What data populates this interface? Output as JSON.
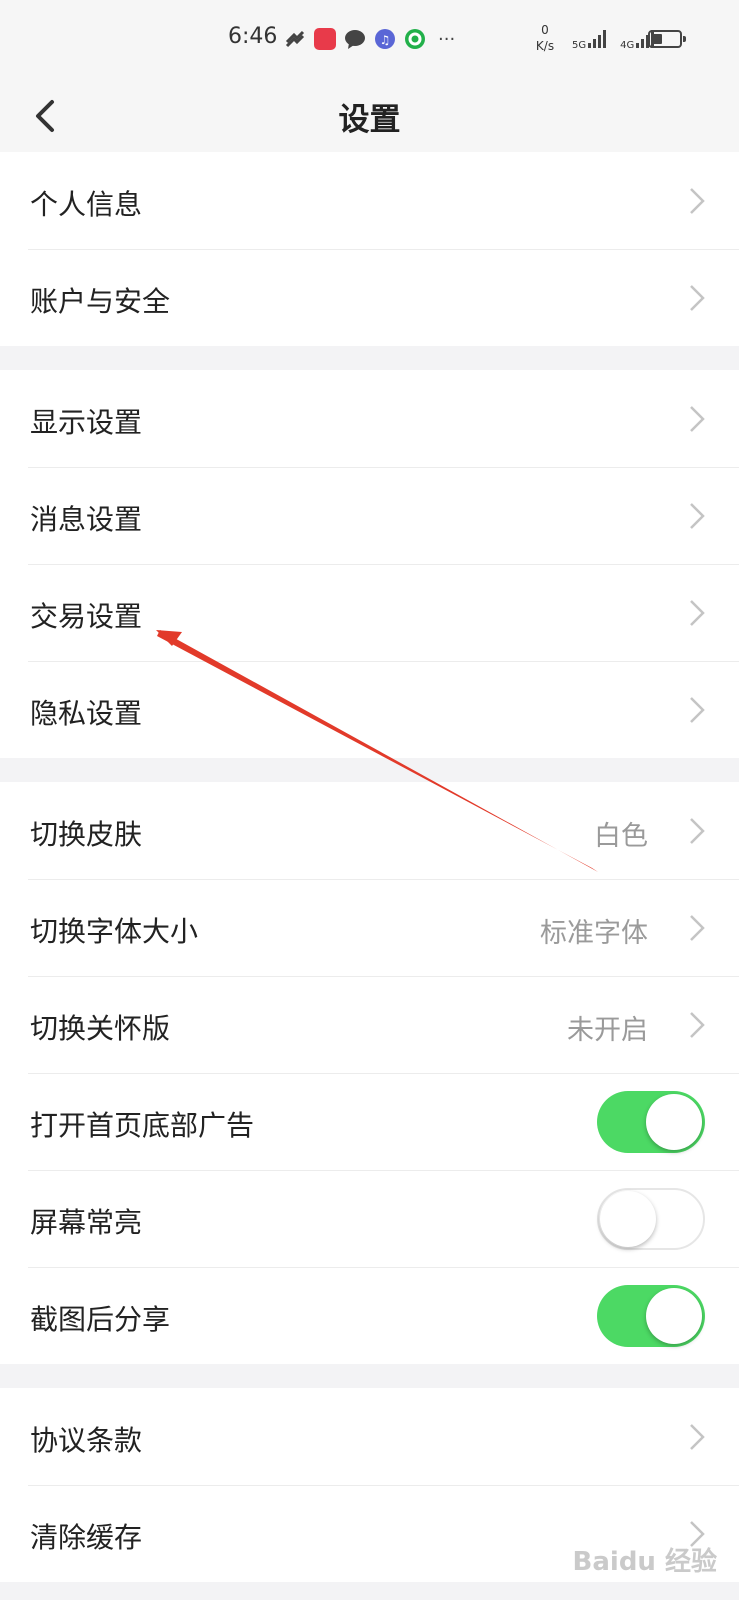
{
  "status_bar": {
    "time": "6:46",
    "net_speed_value": "0",
    "net_speed_unit": "K/s",
    "signal_1": "5G",
    "signal_2": "4G",
    "icons": [
      "heart-link-icon",
      "app-red-icon",
      "chat-bubble-icon",
      "music-icon",
      "green-c-icon",
      "more-dots-icon"
    ]
  },
  "nav": {
    "title": "设置",
    "back_icon": "chevron-left-icon"
  },
  "groups": [
    {
      "items": [
        {
          "label": "个人信息"
        },
        {
          "label": "账户与安全"
        }
      ]
    },
    {
      "items": [
        {
          "label": "显示设置"
        },
        {
          "label": "消息设置"
        },
        {
          "label": "交易设置"
        },
        {
          "label": "隐私设置"
        }
      ]
    },
    {
      "items": [
        {
          "label": "切换皮肤",
          "value": "白色"
        },
        {
          "label": "切换字体大小",
          "value": "标准字体"
        },
        {
          "label": "切换关怀版",
          "value": "未开启"
        },
        {
          "label": "打开首页底部广告",
          "toggle": true
        },
        {
          "label": "屏幕常亮",
          "toggle": false
        },
        {
          "label": "截图后分享",
          "toggle": true
        }
      ]
    },
    {
      "items": [
        {
          "label": "协议条款"
        },
        {
          "label": "清除缓存"
        }
      ]
    }
  ],
  "colors": {
    "toggle_on": "#4cd964",
    "annotation_arrow": "#e23a2a",
    "page_bg": "#f3f3f5"
  },
  "watermark": "Baidu 经验"
}
